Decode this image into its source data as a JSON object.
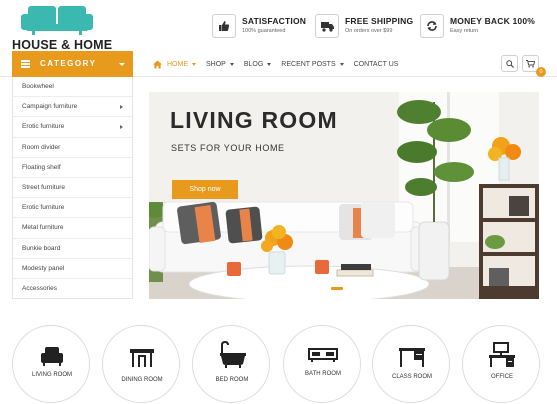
{
  "brand": {
    "name": "HOUSE & HOME"
  },
  "features": [
    {
      "title": "SATISFACTION",
      "subtitle": "100% guaranteed",
      "icon": "thumbs-up-icon"
    },
    {
      "title": "FREE SHIPPING",
      "subtitle": "On orders over $99",
      "icon": "truck-icon"
    },
    {
      "title": "MONEY BACK 100%",
      "subtitle": "Easy return",
      "icon": "refresh-icon"
    }
  ],
  "category": {
    "label": "CATEGORY",
    "items": [
      {
        "label": "Bookwheel",
        "has_sub": false
      },
      {
        "label": "Campaign furniture",
        "has_sub": true
      },
      {
        "label": "Erotic furniture",
        "has_sub": true
      },
      {
        "label": "Room divider",
        "has_sub": false
      },
      {
        "label": "Floating shelf",
        "has_sub": false
      },
      {
        "label": "Street furniture",
        "has_sub": false
      },
      {
        "label": "Erotic furniture",
        "has_sub": false
      },
      {
        "label": "Metal furniture",
        "has_sub": false
      },
      {
        "label": "Bunkie board",
        "has_sub": false
      },
      {
        "label": "Modesty panel",
        "has_sub": false
      },
      {
        "label": "Accessories",
        "has_sub": false
      }
    ]
  },
  "nav": {
    "items": [
      {
        "label": "HOME",
        "active": true,
        "dropdown": true
      },
      {
        "label": "SHOP",
        "active": false,
        "dropdown": true
      },
      {
        "label": "BLOG",
        "active": false,
        "dropdown": true
      },
      {
        "label": "RECENT POSTS",
        "active": false,
        "dropdown": true
      },
      {
        "label": "CONTACT US",
        "active": false,
        "dropdown": false
      }
    ],
    "cart_count": "0"
  },
  "banner": {
    "title": "LIVING ROOM",
    "subtitle": "SETS FOR YOUR HOME",
    "button": "Shop now"
  },
  "rooms": [
    {
      "label": "LIVING ROOM",
      "icon": "armchair-icon"
    },
    {
      "label": "DINING ROOM",
      "icon": "dining-table-icon"
    },
    {
      "label": "BED ROOM",
      "icon": "bathtub-icon"
    },
    {
      "label": "BATH ROOM",
      "icon": "tv-stand-icon"
    },
    {
      "label": "CLASS ROOM",
      "icon": "desk-icon"
    },
    {
      "label": "OFFICE",
      "icon": "office-desk-icon"
    }
  ],
  "colors": {
    "accent": "#e89a1d",
    "logo": "#3bb8b0",
    "text": "#333333"
  }
}
